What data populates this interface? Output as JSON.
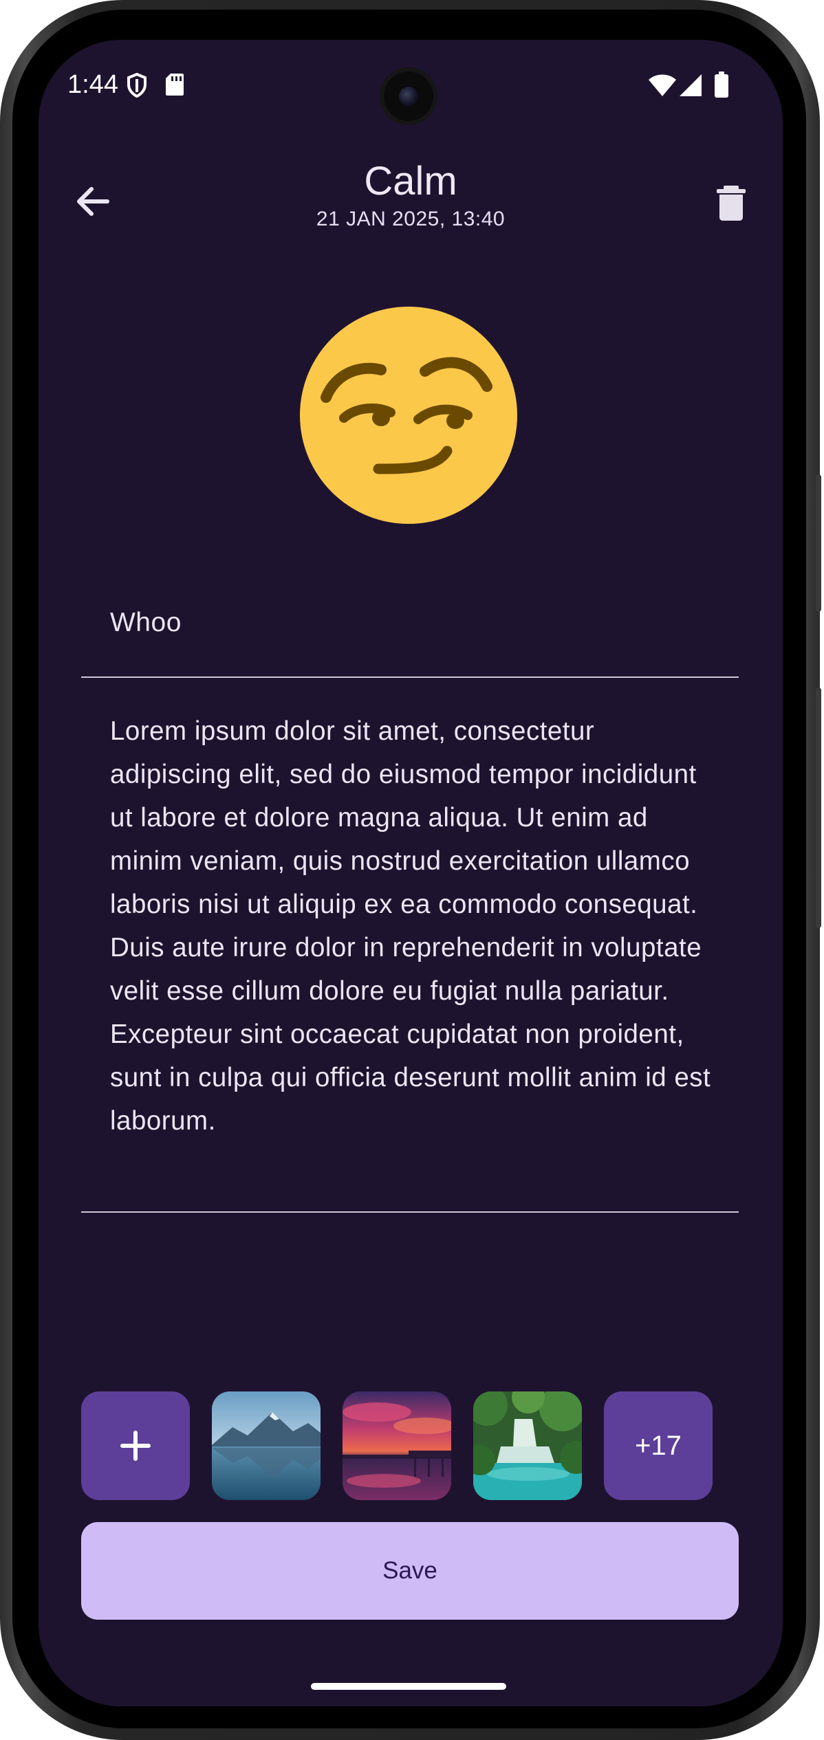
{
  "status_bar": {
    "time": "1:44",
    "left_icons": [
      "shield-icon",
      "sd-card-icon"
    ],
    "right_icons": [
      "wifi-icon",
      "signal-icon",
      "battery-icon"
    ]
  },
  "header": {
    "title": "Calm",
    "date": "21 JAN 2025, 13:40",
    "back_icon": "arrow-back-icon",
    "delete_icon": "trash-icon"
  },
  "mood": {
    "emoji_icon": "smirking-face-icon"
  },
  "entry": {
    "title_value": "Whoo",
    "body_value": "Lorem ipsum dolor sit amet, consectetur adipiscing elit, sed do eiusmod tempor incididunt ut labore et dolore magna aliqua. Ut enim ad minim veniam, quis nostrud exercitation ullamco laboris nisi ut aliquip ex ea commodo consequat. Duis aute irure dolor in reprehenderit in voluptate velit esse cillum dolore eu fugiat nulla pariatur. Excepteur sint occaecat cupidatat non proident, sunt in culpa qui officia deserunt mollit anim id est laborum."
  },
  "attachments": {
    "add_label": "+",
    "photos": [
      "mountain-lake-photo",
      "sunset-pier-photo",
      "waterfall-photo"
    ],
    "more_label": "+17"
  },
  "actions": {
    "save_label": "Save"
  },
  "colors": {
    "background": "#1e132f",
    "accent_tile": "#5d3f99",
    "save_button": "#cfbcf7",
    "save_text": "#2b1a55",
    "emoji_face": "#fcc84a",
    "emoji_features": "#6a4a00"
  }
}
